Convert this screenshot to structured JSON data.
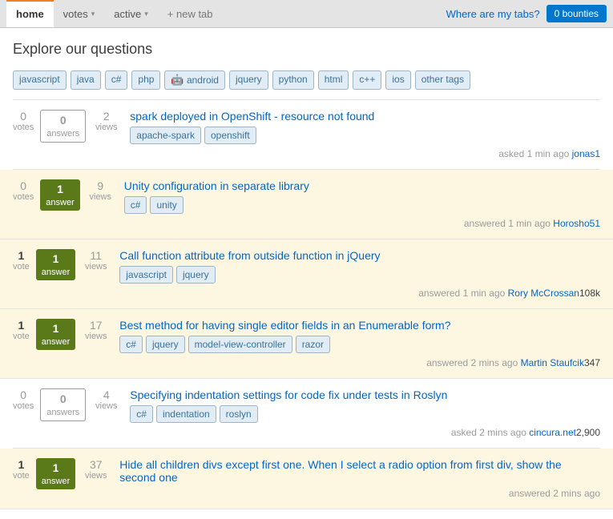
{
  "nav": {
    "tabs": [
      {
        "id": "home",
        "label": "home",
        "active": true
      },
      {
        "id": "votes",
        "label": "votes",
        "hasCaret": true
      },
      {
        "id": "active",
        "label": "active",
        "hasCaret": true
      }
    ],
    "new_tab_label": "+ new tab",
    "where_tabs_label": "Where are my tabs?",
    "bounties_label": "0 bounties"
  },
  "explore": {
    "title": "Explore our questions",
    "tags": [
      "javascript",
      "java",
      "c#",
      "php",
      "android",
      "jquery",
      "python",
      "html",
      "c++",
      "ios",
      "other tags"
    ]
  },
  "questions": [
    {
      "id": 1,
      "votes": 0,
      "votes_label": "votes",
      "answers": 0,
      "answers_label": "answers",
      "views": 2,
      "views_label": "views",
      "has_answer": false,
      "title": "spark deployed in OpenShift - resource not found",
      "tags": [
        "apache-spark",
        "openshift"
      ],
      "meta": "asked 1 min ago",
      "user": "jonas1",
      "user_rep": "",
      "highlighted": false
    },
    {
      "id": 2,
      "votes": 0,
      "votes_label": "votes",
      "answers": 1,
      "answers_label": "answer",
      "views": 9,
      "views_label": "views",
      "has_answer": true,
      "title": "Unity configuration in separate library",
      "tags": [
        "c#",
        "unity"
      ],
      "meta": "answered 1 min ago",
      "user": "Horosho51",
      "user_rep": "",
      "highlighted": true
    },
    {
      "id": 3,
      "votes": 1,
      "votes_label": "vote",
      "answers": 1,
      "answers_label": "answer",
      "views": 11,
      "views_label": "views",
      "has_answer": true,
      "title": "Call function attribute from outside function in jQuery",
      "tags": [
        "javascript",
        "jquery"
      ],
      "meta": "answered 1 min ago",
      "user": "Rory McCrossan",
      "user_rep": "108k",
      "highlighted": true
    },
    {
      "id": 4,
      "votes": 1,
      "votes_label": "vote",
      "answers": 1,
      "answers_label": "answer",
      "views": 17,
      "views_label": "views",
      "has_answer": true,
      "title": "Best method for having single editor fields in an Enumerable form?",
      "tags": [
        "c#",
        "jquery",
        "model-view-controller",
        "razor"
      ],
      "meta": "answered 2 mins ago",
      "user": "Martin Staufcik",
      "user_rep": "347",
      "highlighted": true
    },
    {
      "id": 5,
      "votes": 0,
      "votes_label": "votes",
      "answers": 0,
      "answers_label": "answers",
      "views": 4,
      "views_label": "views",
      "has_answer": false,
      "title": "Specifying indentation settings for code fix under tests in Roslyn",
      "tags": [
        "c#",
        "indentation",
        "roslyn"
      ],
      "meta": "asked 2 mins ago",
      "user": "cincura.net",
      "user_rep": "2,900",
      "highlighted": false
    },
    {
      "id": 6,
      "votes": 1,
      "votes_label": "vote",
      "answers": 1,
      "answers_label": "answer",
      "views": 37,
      "views_label": "views",
      "has_answer": true,
      "title": "Hide all children divs except first one. When I select a radio option from first div, show the second one",
      "tags": [],
      "meta": "answered 2 mins ago",
      "user": "",
      "user_rep": "",
      "highlighted": true
    }
  ]
}
